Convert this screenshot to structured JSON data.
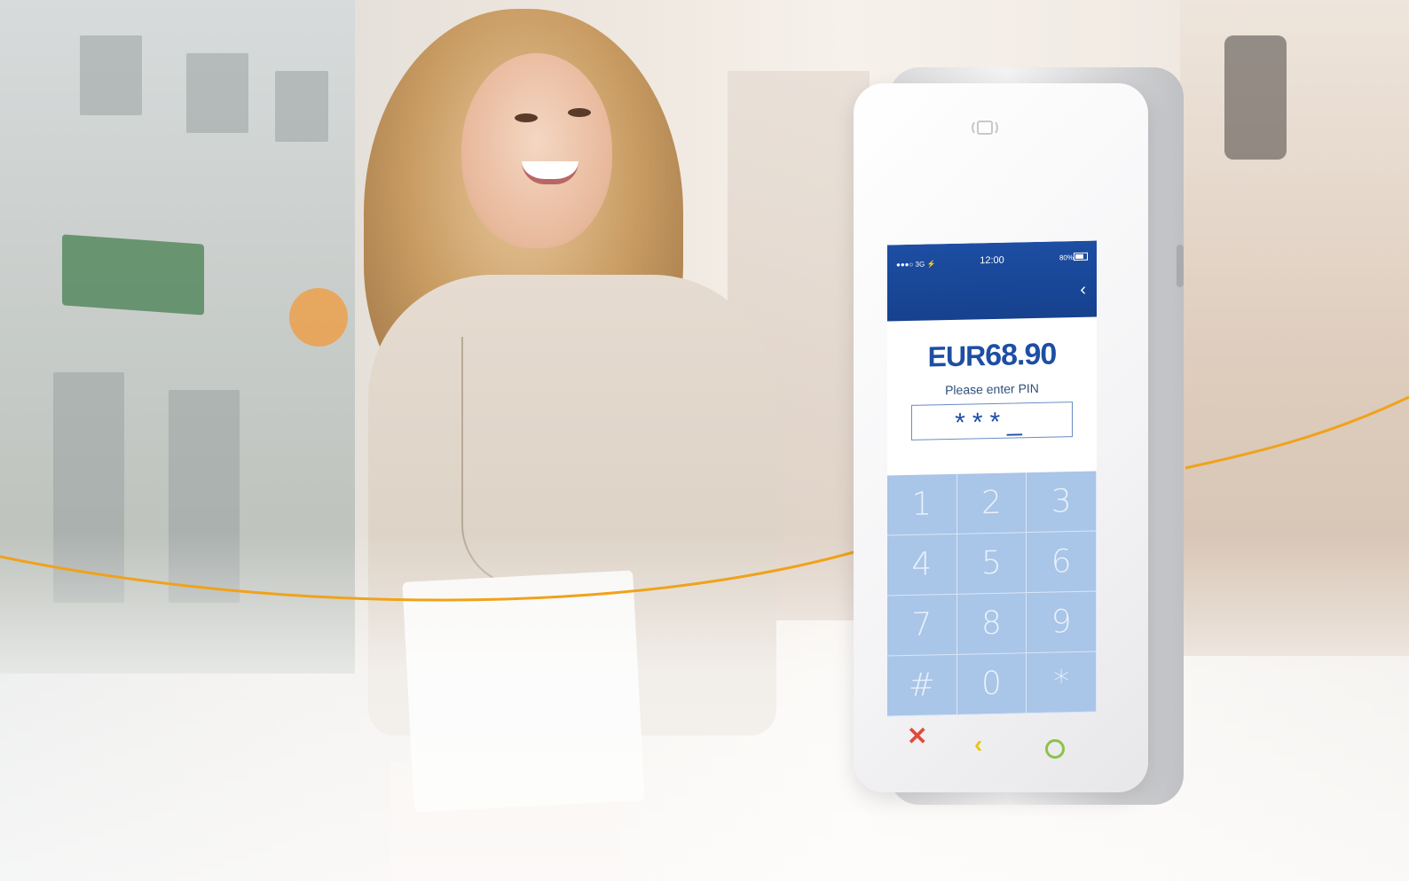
{
  "scene": {
    "accent_color": "#f0a21a"
  },
  "terminal": {
    "status_signal": "●●●○ 3G ⚡",
    "status_time": "12:00",
    "status_battery": "80%",
    "amount_currency": "EUR",
    "amount_value": "68.90",
    "prompt": "Please enter PIN",
    "pin_display": "***_",
    "screen_color": "#1d4ea3",
    "keypad_color": "#a9c5e8",
    "keys": [
      "1",
      "2",
      "3",
      "4",
      "5",
      "6",
      "7",
      "8",
      "9",
      "#",
      "0",
      "*"
    ],
    "hw_buttons": {
      "cancel": "✕",
      "back": "‹",
      "ok_icon": "circle-icon"
    }
  }
}
